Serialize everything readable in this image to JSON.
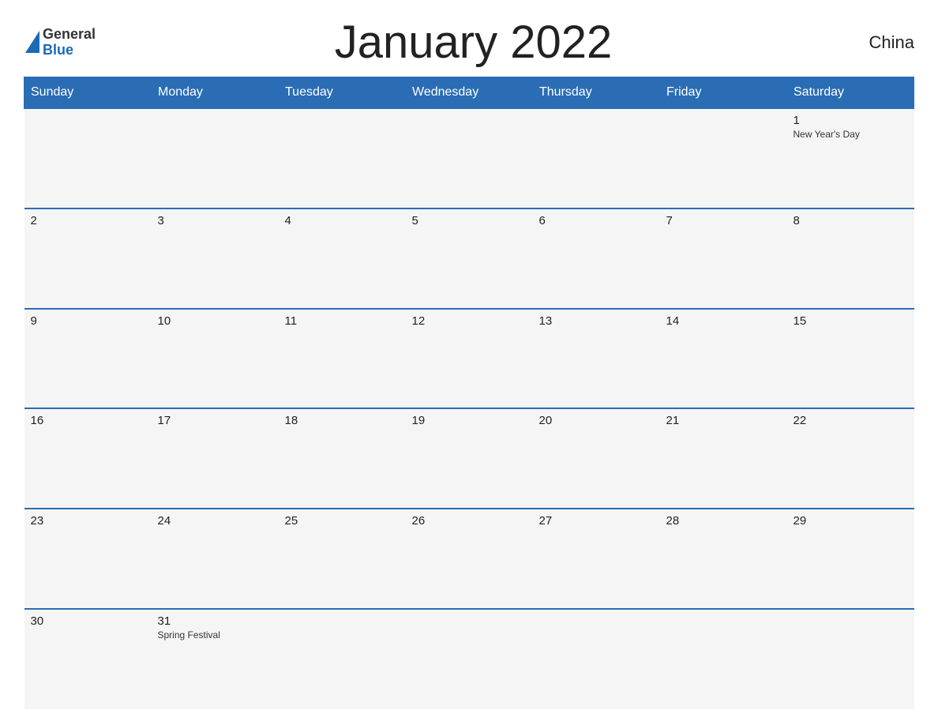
{
  "header": {
    "logo_general": "General",
    "logo_blue": "Blue",
    "title": "January 2022",
    "country": "China"
  },
  "weekdays": [
    "Sunday",
    "Monday",
    "Tuesday",
    "Wednesday",
    "Thursday",
    "Friday",
    "Saturday"
  ],
  "weeks": [
    [
      {
        "date": "",
        "event": ""
      },
      {
        "date": "",
        "event": ""
      },
      {
        "date": "",
        "event": ""
      },
      {
        "date": "",
        "event": ""
      },
      {
        "date": "",
        "event": ""
      },
      {
        "date": "",
        "event": ""
      },
      {
        "date": "1",
        "event": "New Year's Day"
      }
    ],
    [
      {
        "date": "2",
        "event": ""
      },
      {
        "date": "3",
        "event": ""
      },
      {
        "date": "4",
        "event": ""
      },
      {
        "date": "5",
        "event": ""
      },
      {
        "date": "6",
        "event": ""
      },
      {
        "date": "7",
        "event": ""
      },
      {
        "date": "8",
        "event": ""
      }
    ],
    [
      {
        "date": "9",
        "event": ""
      },
      {
        "date": "10",
        "event": ""
      },
      {
        "date": "11",
        "event": ""
      },
      {
        "date": "12",
        "event": ""
      },
      {
        "date": "13",
        "event": ""
      },
      {
        "date": "14",
        "event": ""
      },
      {
        "date": "15",
        "event": ""
      }
    ],
    [
      {
        "date": "16",
        "event": ""
      },
      {
        "date": "17",
        "event": ""
      },
      {
        "date": "18",
        "event": ""
      },
      {
        "date": "19",
        "event": ""
      },
      {
        "date": "20",
        "event": ""
      },
      {
        "date": "21",
        "event": ""
      },
      {
        "date": "22",
        "event": ""
      }
    ],
    [
      {
        "date": "23",
        "event": ""
      },
      {
        "date": "24",
        "event": ""
      },
      {
        "date": "25",
        "event": ""
      },
      {
        "date": "26",
        "event": ""
      },
      {
        "date": "27",
        "event": ""
      },
      {
        "date": "28",
        "event": ""
      },
      {
        "date": "29",
        "event": ""
      }
    ],
    [
      {
        "date": "30",
        "event": ""
      },
      {
        "date": "31",
        "event": "Spring Festival"
      },
      {
        "date": "",
        "event": ""
      },
      {
        "date": "",
        "event": ""
      },
      {
        "date": "",
        "event": ""
      },
      {
        "date": "",
        "event": ""
      },
      {
        "date": "",
        "event": ""
      }
    ]
  ]
}
